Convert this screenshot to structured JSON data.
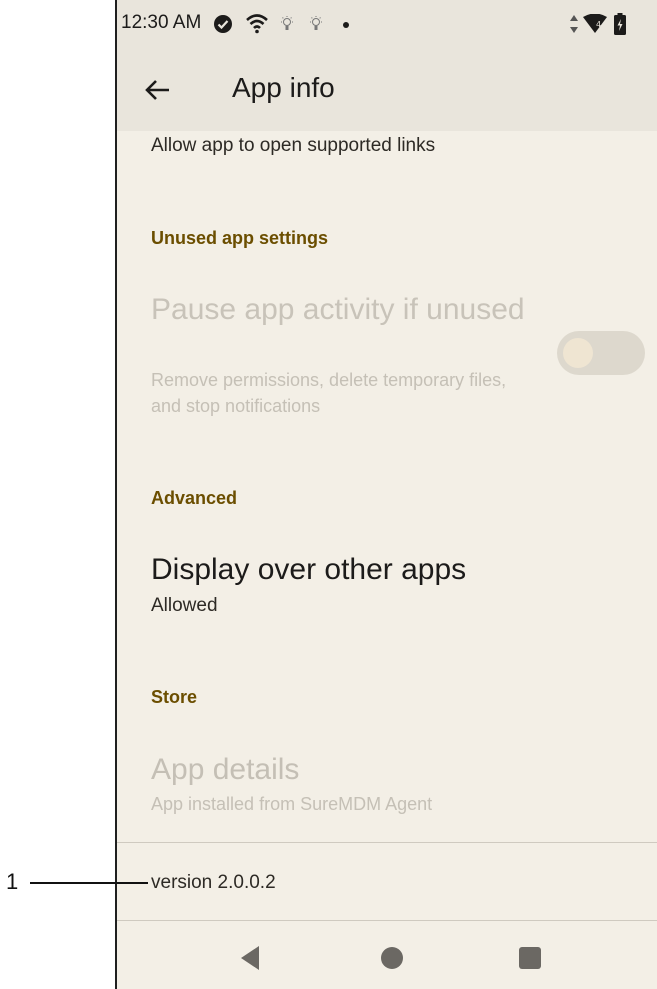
{
  "status_bar": {
    "time": "12:30 AM",
    "icons": [
      "check-circle-icon",
      "wifi-icon",
      "bulb-icon",
      "bulb-icon",
      "dot-icon",
      "data-arrows-icon",
      "signal-icon",
      "battery-icon"
    ]
  },
  "app_bar": {
    "title": "App info",
    "back_icon": "arrow-left-icon"
  },
  "content": {
    "open_links_desc": "Allow app to open supported links",
    "unused_section": "Unused app settings",
    "pause_title": "Pause app activity if unused",
    "pause_desc": "Remove permissions, delete temporary files, and stop notifications",
    "pause_toggle_on": false,
    "advanced_section": "Advanced",
    "display_title": "Display over other apps",
    "display_desc": "Allowed",
    "store_section": "Store",
    "details_title": "App details",
    "details_desc": "App installed from SureMDM Agent",
    "version": "version 2.0.0.2"
  },
  "nav_bar": {
    "icons": [
      "back-triangle-icon",
      "home-circle-icon",
      "recents-square-icon"
    ]
  },
  "callout": {
    "number": "1"
  },
  "colors": {
    "background": "#f3efe6",
    "header": "#e9e5dc",
    "section_header": "#6b4e00"
  }
}
